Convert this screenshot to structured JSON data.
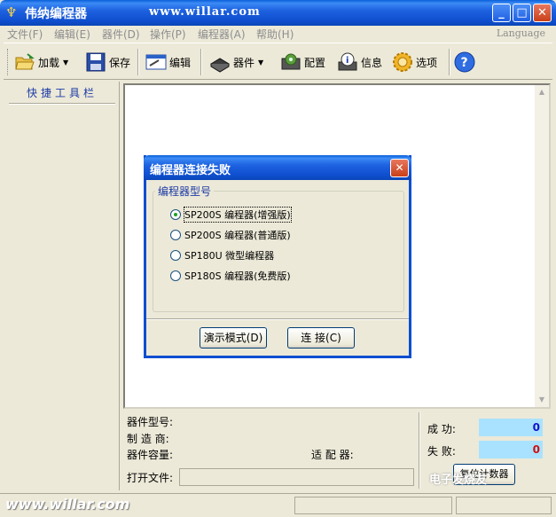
{
  "window": {
    "title": "伟纳编程器",
    "url_text": "www.willar.com",
    "min_label": "_",
    "max_label": "□",
    "close_label": "✕"
  },
  "menu": {
    "items": [
      "文件(F)",
      "编辑(E)",
      "器件(D)",
      "操作(P)",
      "编程器(A)",
      "帮助(H)"
    ],
    "language": "Language"
  },
  "toolbar": {
    "load": "加载",
    "save": "保存",
    "edit": "编辑",
    "device": "器件",
    "config": "配置",
    "info": "信息",
    "options": "选项"
  },
  "quickbar": {
    "title": "快捷工具栏"
  },
  "dialog": {
    "title": "编程器连接失败",
    "group_label": "编程器型号",
    "options": [
      "SP200S 编程器(增强版)",
      "SP200S 编程器(普通版)",
      "SP180U 微型编程器",
      "SP180S 编程器(免费版)"
    ],
    "selected_index": 0,
    "demo_button": "演示模式(D)",
    "connect_button": "连 接(C)"
  },
  "info": {
    "device_model": "器件型号:",
    "manufacturer": "制 造 商:",
    "capacity": "器件容量:",
    "adapter": "适 配 器:",
    "open_file": "打开文件:",
    "success_label": "成 功:",
    "fail_label": "失 败:",
    "success_count": "0",
    "fail_count": "0",
    "reset_button": "复位计数器"
  },
  "statusbar": {
    "logo": "www.willar.com"
  },
  "watermark": "电子发烧友",
  "colors": {
    "success_count": "#1111cc",
    "fail_count": "#cc1111",
    "counter_bg": "#a9e2ff"
  }
}
